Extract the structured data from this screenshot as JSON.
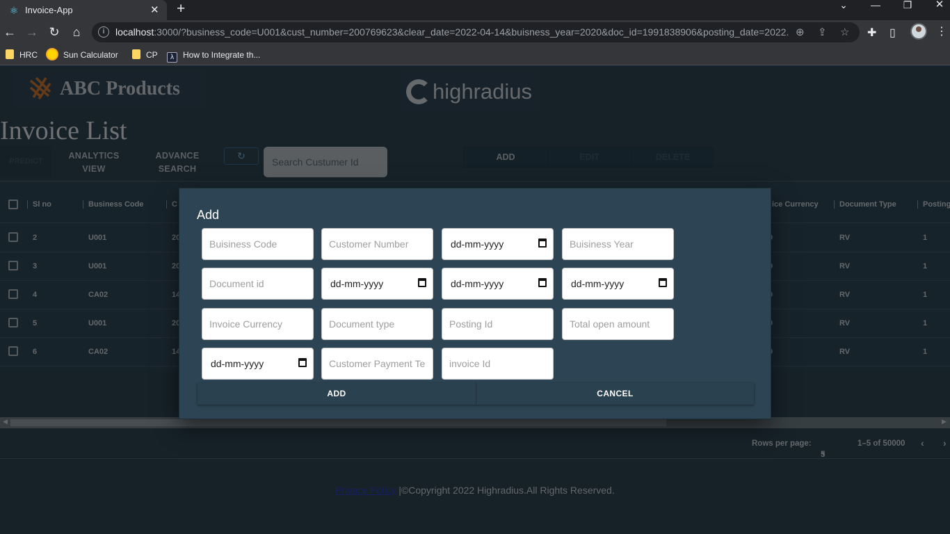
{
  "browser": {
    "tab_title": "Invoice-App",
    "tab_close": "✕",
    "new_tab": "+",
    "url_host": "localhost",
    "url_rest": ":3000/?business_code=U001&cust_number=200769623&clear_date=2022-04-14&buisness_year=2020&doc_id=1991838906&posting_date=2022...",
    "bookmarks": [
      "HRC",
      "Sun Calculator",
      "CP",
      "How to Integrate th..."
    ]
  },
  "app": {
    "brand": "ABC Products",
    "partner_logo": "highradius",
    "page_title": "Invoice List",
    "toolbar": {
      "predict": "PREDICT",
      "analytics_line1": "ANALYTICS",
      "analytics_line2": "VIEW",
      "advance_line1": "ADVANCE",
      "advance_line2": "SEARCH",
      "search_placeholder": "Search Custumer Id",
      "add": "ADD",
      "edit": "EDIT",
      "delete": "DELETE"
    },
    "table": {
      "headers": [
        "Sl no",
        "Business Code",
        "C",
        "ice Currency",
        "Document Type",
        "Posting"
      ],
      "rows": [
        {
          "sl": "2",
          "code": "U001",
          "c": "20",
          "cur": "0",
          "doc": "RV",
          "post": "1"
        },
        {
          "sl": "3",
          "code": "U001",
          "c": "20",
          "cur": "0",
          "doc": "RV",
          "post": "1"
        },
        {
          "sl": "4",
          "code": "CA02",
          "c": "14",
          "cur": "0",
          "doc": "RV",
          "post": "1"
        },
        {
          "sl": "5",
          "code": "U001",
          "c": "20",
          "cur": "0",
          "doc": "RV",
          "post": "1"
        },
        {
          "sl": "6",
          "code": "CA02",
          "c": "14",
          "cur": "0",
          "doc": "RV",
          "post": "1"
        }
      ]
    },
    "pagination": {
      "rows_per_page_label": "Rows per page:",
      "rows_per_page_value": "5",
      "range": "1–5 of 50000"
    },
    "footer": {
      "privacy_link": "Privacy Policy",
      "copyright": " |©Copyright 2022 Highradius.All Rights Reserved."
    }
  },
  "modal": {
    "title": "Add",
    "fields": {
      "business_code": "Buisiness Code",
      "customer_number": "Customer Number",
      "date1": "dd-mm-yyyy",
      "business_year": "Buisiness Year",
      "document_id": "Document id",
      "date2": "dd-mm-yyyy",
      "date3": "dd-mm-yyyy",
      "date4": "dd-mm-yyyy",
      "invoice_currency": "Invoice Currency",
      "document_type": "Document type",
      "posting_id": "Posting Id",
      "total_open_amount": "Total open amount",
      "date5": "dd-mm-yyyy",
      "customer_payment_terms": "Customer Payment Terr",
      "invoice_id": "invoice Id"
    },
    "add_label": "ADD",
    "cancel_label": "CANCEL"
  }
}
